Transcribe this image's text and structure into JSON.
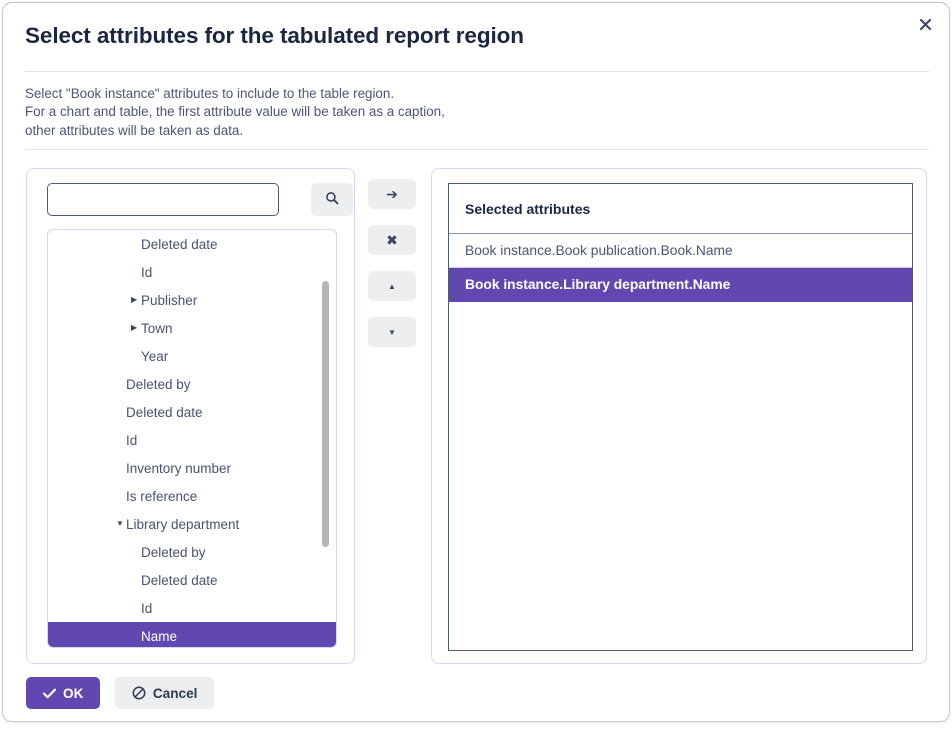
{
  "dialog": {
    "title": "Select attributes for the tabulated report region",
    "close_label": "✖",
    "description_lines": [
      "Select \"Book instance\" attributes to include to the table region.",
      "For a chart and table, the first attribute value will be taken as a caption,",
      "other attributes will be taken as data."
    ]
  },
  "search": {
    "value": "",
    "placeholder": "",
    "button_label": ""
  },
  "tree": {
    "items": [
      {
        "label": "Deleted date",
        "level": 2,
        "caret": "",
        "selected": false
      },
      {
        "label": "Id",
        "level": 2,
        "caret": "",
        "selected": false
      },
      {
        "label": "Publisher",
        "level": 2,
        "caret": "▶",
        "selected": false
      },
      {
        "label": "Town",
        "level": 2,
        "caret": "▶",
        "selected": false
      },
      {
        "label": "Year",
        "level": 2,
        "caret": "",
        "selected": false
      },
      {
        "label": "Deleted by",
        "level": 1,
        "caret": "",
        "selected": false
      },
      {
        "label": "Deleted date",
        "level": 1,
        "caret": "",
        "selected": false
      },
      {
        "label": "Id",
        "level": 1,
        "caret": "",
        "selected": false
      },
      {
        "label": "Inventory number",
        "level": 1,
        "caret": "",
        "selected": false
      },
      {
        "label": "Is reference",
        "level": 1,
        "caret": "",
        "selected": false
      },
      {
        "label": "Library department",
        "level": 1,
        "caret": "▼",
        "selected": false
      },
      {
        "label": "Deleted by",
        "level": 2,
        "caret": "",
        "selected": false
      },
      {
        "label": "Deleted date",
        "level": 2,
        "caret": "",
        "selected": false
      },
      {
        "label": "Id",
        "level": 2,
        "caret": "",
        "selected": false
      },
      {
        "label": "Name",
        "level": 2,
        "caret": "",
        "selected": true
      }
    ]
  },
  "transfer_buttons": [
    {
      "name": "add",
      "glyph": "➔"
    },
    {
      "name": "remove",
      "glyph": "✖"
    },
    {
      "name": "move-up",
      "glyph": "▲"
    },
    {
      "name": "move-down",
      "glyph": "▼"
    }
  ],
  "selected_panel": {
    "header": "Selected attributes",
    "items": [
      {
        "label": "Book instance.Book publication.Book.Name",
        "selected": false
      },
      {
        "label": "Book instance.Library department.Name",
        "selected": true
      }
    ]
  },
  "footer": {
    "ok_label": "OK",
    "cancel_label": "Cancel"
  },
  "colors": {
    "accent_purple": "#6148b0",
    "title_navy": "#1b2640",
    "text_slate": "#4b5674",
    "panel_border": "#d9d6ef",
    "button_grey": "#eceef0"
  }
}
